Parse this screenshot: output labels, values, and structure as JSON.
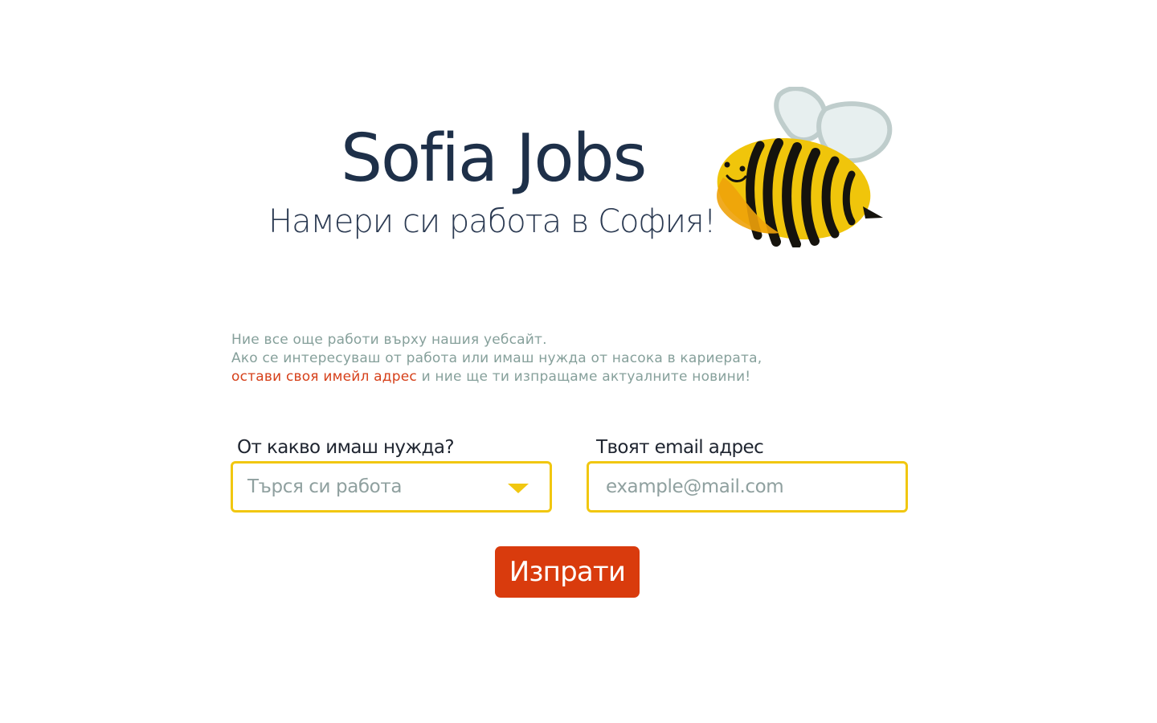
{
  "header": {
    "title": "Sofia Jobs",
    "subtitle": "Намери си работа в София!",
    "mascot": "bee-icon"
  },
  "notice": {
    "line1": "Ние все още работи върху нашия уебсайт.",
    "line2": "Ако се интересуваш от работа или имаш нужда от насока в кариерата,",
    "line3_accent": "остави своя имейл адрес",
    "line3_rest": " и ние ще ти изпращаме актуалните новини!"
  },
  "form": {
    "need_label": "От какво имаш нужда?",
    "need_selected": "Търся си работа",
    "email_label": "Твоят email адрес",
    "email_placeholder": "example@mail.com",
    "submit_label": "Изпрати"
  },
  "colors": {
    "title": "#1e3049",
    "notice": "#86a09b",
    "accent": "#d6401a",
    "field_border": "#f1c710",
    "button": "#d93b0d"
  },
  "icons": {
    "dropdown": "chevron-down-icon",
    "mascot": "bee-icon"
  }
}
